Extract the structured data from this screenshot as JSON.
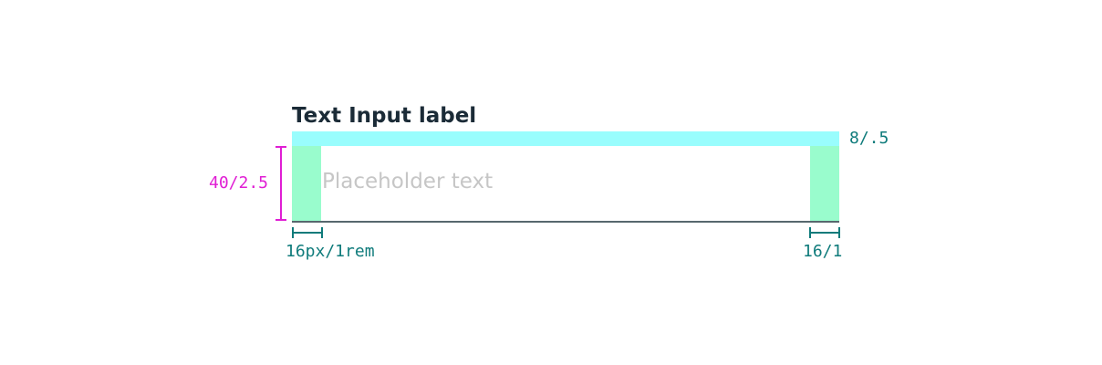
{
  "text_input": {
    "label": "Text Input label",
    "placeholder": "Placeholder text"
  },
  "annotations": {
    "label_gap": "8/.5",
    "field_height": "40/2.5",
    "padding_left": "16px/1rem",
    "padding_right": "16/1"
  },
  "colors": {
    "label_gap_highlight": "#99fdfd",
    "padding_highlight": "#99fccd",
    "height_marker": "#e01ed4",
    "padding_marker": "#0f7b7b",
    "field_underline": "#57686e",
    "placeholder_text": "#c6c6c6",
    "label_text": "#1b2b37"
  }
}
